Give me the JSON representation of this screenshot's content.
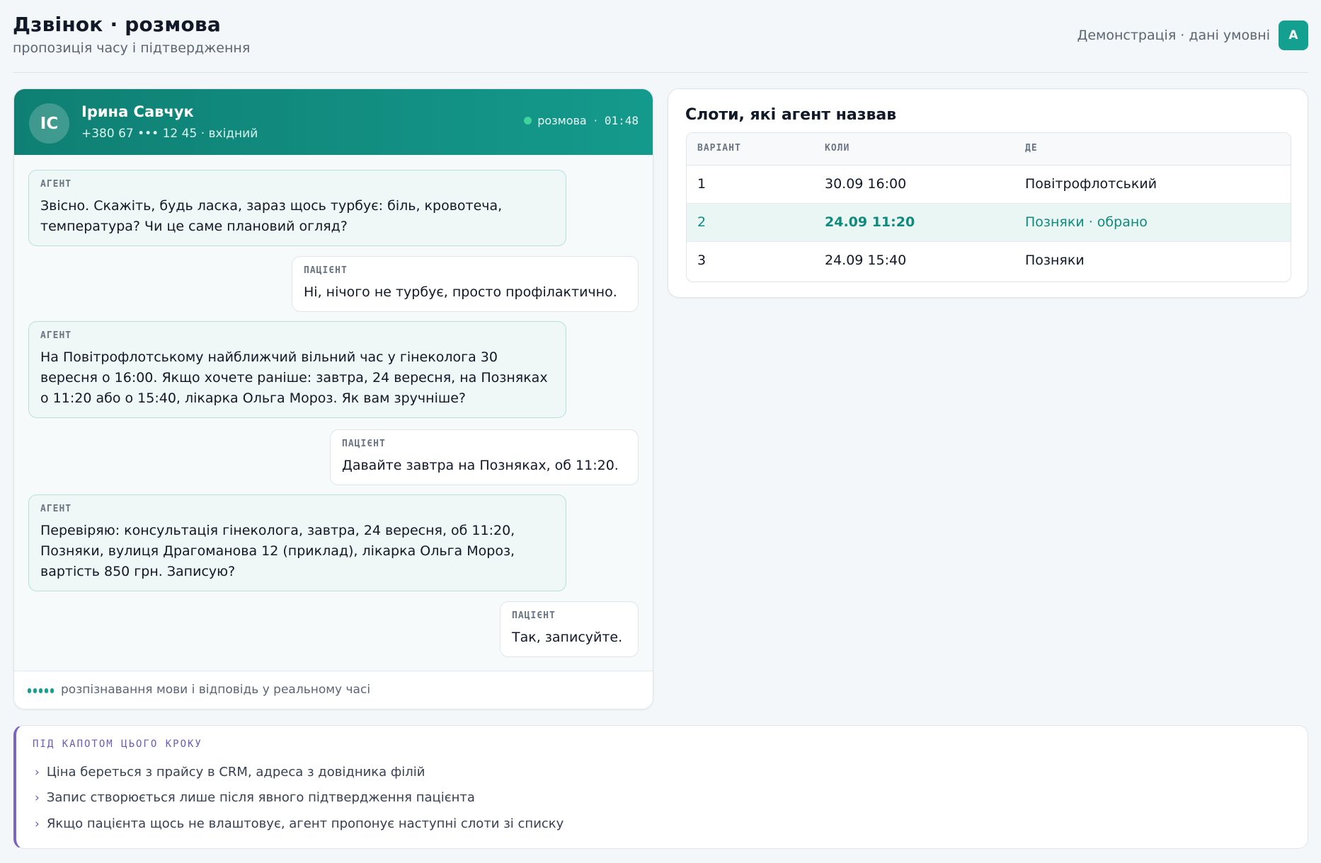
{
  "header": {
    "title": "Дзвінок · розмова",
    "subtitle": "пропозиція часу і підтвердження",
    "demo_label": "Демонстрація · дані умовні",
    "avatar_letter": "A"
  },
  "call": {
    "caller_initials": "ІС",
    "caller_name": "Ірина Савчук",
    "caller_meta": "+380 67 ••• 12 45 · вхідний",
    "status_label": "розмова",
    "status_separator": "·",
    "duration": "01:48",
    "messages": [
      {
        "role": "АГЕНТ",
        "text": "Звісно. Скажіть, будь ласка, зараз щось турбує: біль, кровотеча, температура? Чи це саме плановий огляд?"
      },
      {
        "role": "ПАЦІЄНТ",
        "text": "Ні, нічого не турбує, просто профілактично."
      },
      {
        "role": "АГЕНТ",
        "text": "На Повітрофлотському найближчий вільний час у гінеколога 30 вересня о 16:00. Якщо хочете раніше: завтра, 24 вересня, на Позняках о 11:20 або о 15:40, лікарка Ольга Мороз. Як вам зручніше?"
      },
      {
        "role": "ПАЦІЄНТ",
        "text": "Давайте завтра на Позняках, об 11:20."
      },
      {
        "role": "АГЕНТ",
        "text": "Перевіряю: консультація гінеколога, завтра, 24 вересня, об 11:20, Позняки, вулиця Драгоманова 12 (приклад), лікарка Ольга Мороз, вартість 850 грн. Записую?"
      },
      {
        "role": "ПАЦІЄНТ",
        "text": "Так, записуйте."
      }
    ],
    "footer_text": "розпізнавання мови і відповідь у реальному часі"
  },
  "slots": {
    "title": "Слоти, які агент назвав",
    "columns": [
      "ВАРІАНТ",
      "КОЛИ",
      "ДЕ"
    ],
    "rows": [
      {
        "variant": "1",
        "when": "30.09 16:00",
        "where": "Повітрофлотський",
        "selected": false
      },
      {
        "variant": "2",
        "when": "24.09 11:20",
        "where": "Позняки · обрано",
        "selected": true
      },
      {
        "variant": "3",
        "when": "24.09 15:40",
        "where": "Позняки",
        "selected": false
      }
    ]
  },
  "hood": {
    "title": "ПІД КАПОТОМ ЦЬОГО КРОКУ",
    "chevron": "›",
    "items": [
      "Ціна береться з прайсу в CRM, адреса з довідника філій",
      "Запис створюється лише після явного підтвердження пацієнта",
      "Якщо пацієнта щось не влаштовує, агент пропонує наступні слоти зі списку"
    ]
  },
  "colors": {
    "accent": "#14a090",
    "header_gradient_start": "#0f7f73",
    "header_gradient_end": "#149a8c",
    "hood_accent": "#7a65c7"
  }
}
